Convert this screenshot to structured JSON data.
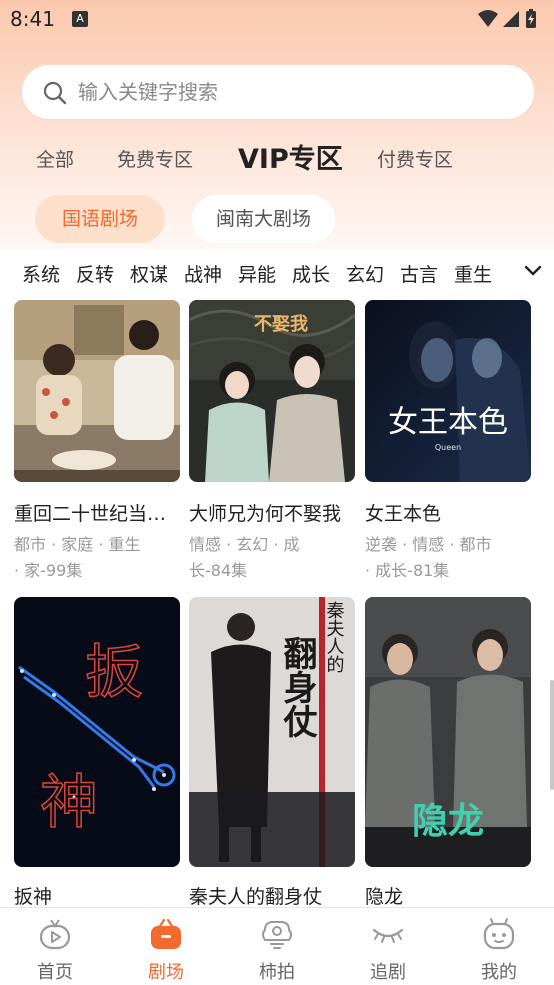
{
  "status_bar": {
    "time": "8:41",
    "notification": "A"
  },
  "search": {
    "placeholder": "输入关键字搜索"
  },
  "zone_tabs": [
    {
      "label": "全部",
      "active": false
    },
    {
      "label": "免费专区",
      "active": false
    },
    {
      "label": "VIP专区",
      "active": true
    },
    {
      "label": "付费专区",
      "active": false
    }
  ],
  "theater_chips": [
    {
      "label": "国语剧场",
      "active": true
    },
    {
      "label": "闽南大剧场",
      "active": false
    }
  ],
  "genres": [
    "系统",
    "反转",
    "权谋",
    "战神",
    "异能",
    "成长",
    "玄幻",
    "古言",
    "重生"
  ],
  "dramas": [
    {
      "title": "重回二十世纪当…",
      "tags": "都市 · 家庭 · 重生",
      "tags2": "· 家-99集"
    },
    {
      "title": "大师兄为何不娶我",
      "tags": "情感 · 玄幻 · 成",
      "tags2": "长-84集",
      "poster_text": "不娶我"
    },
    {
      "title": "女王本色",
      "tags": "逆袭 · 情感 · 都市",
      "tags2": "· 成长-81集",
      "poster_text": "女王本色",
      "poster_sub": "Queen"
    },
    {
      "title": "扳神",
      "poster_text_1": "扳",
      "poster_text_2": "神"
    },
    {
      "title": "秦夫人的翻身仗",
      "poster_text_1": "秦夫人的",
      "poster_text_2": "翻身仗"
    },
    {
      "title": "隐龙",
      "poster_text": "隐龙"
    }
  ],
  "bottom_nav": [
    {
      "label": "首页",
      "icon": "play-tv-icon",
      "active": false
    },
    {
      "label": "剧场",
      "icon": "theater-bag-icon",
      "active": true
    },
    {
      "label": "柿拍",
      "icon": "camera-icon",
      "active": false
    },
    {
      "label": "追剧",
      "icon": "eye-closed-icon",
      "active": false
    },
    {
      "label": "我的",
      "icon": "robot-face-icon",
      "active": false
    }
  ],
  "colors": {
    "accent": "#f26a2e",
    "chip_active_bg": "#fde0cc",
    "header_gradient_top": "#fbc8ad"
  }
}
